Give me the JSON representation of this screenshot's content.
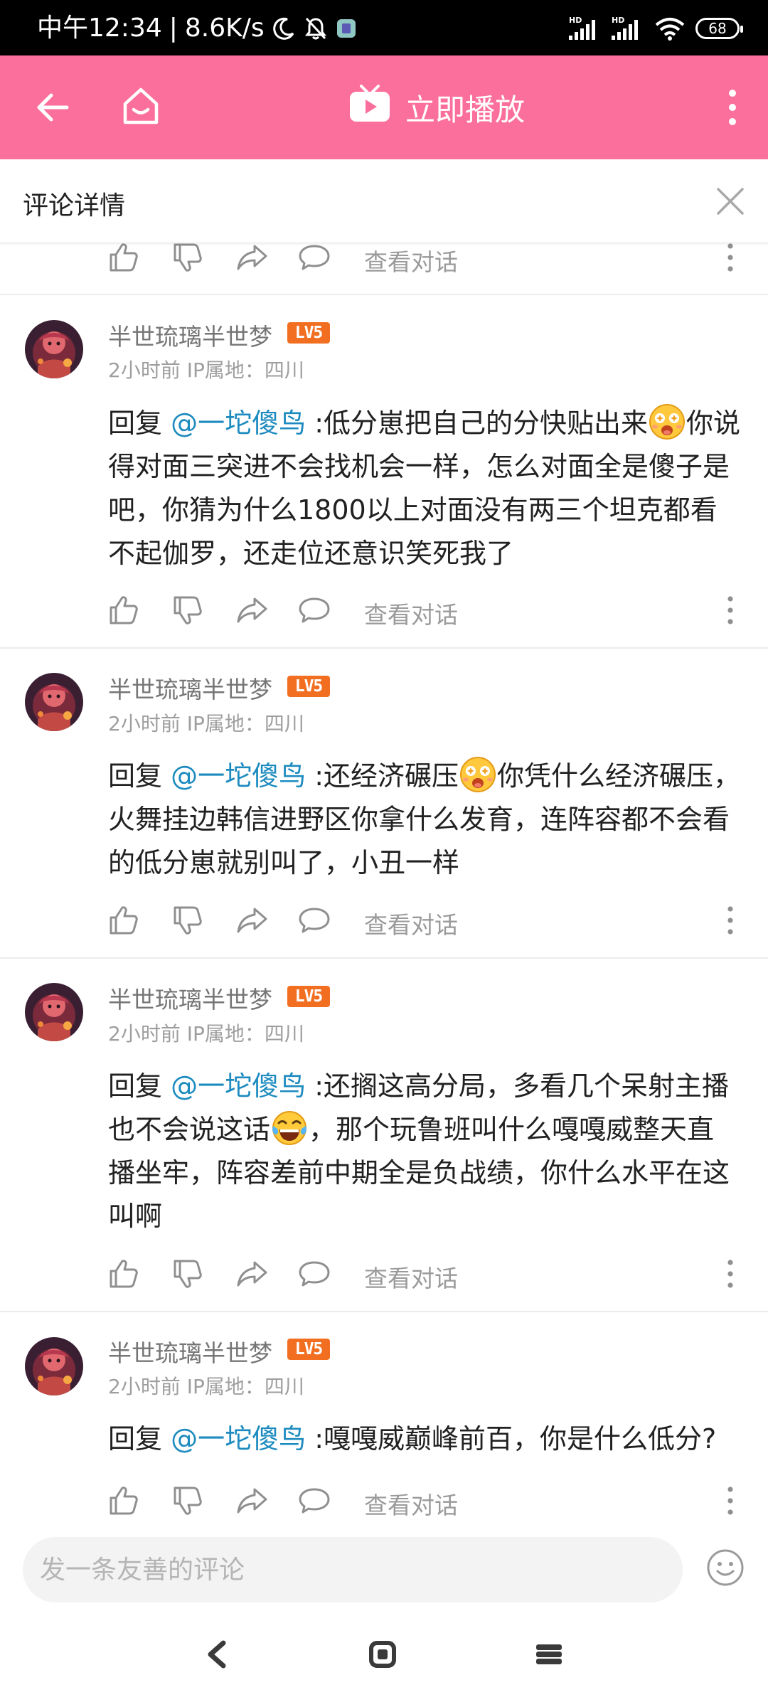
{
  "status_bar": {
    "time": "中午12:34",
    "speed": "8.6K/s",
    "separator": "|",
    "signal_label": "HD",
    "battery": "68"
  },
  "app_bar": {
    "play_label": "立即播放",
    "accent_color": "#fb6f9c"
  },
  "detail": {
    "title": "评论详情"
  },
  "actions": {
    "view_conversation": "查看对话"
  },
  "comments": [
    {
      "username": "半世琉璃半世梦",
      "level": "LV5",
      "time": "2小时前",
      "ip": "IP属地：四川",
      "prefix": "回复 ",
      "mention": "@一坨傻鸟",
      "text_a": " :低分崽把自己的分快贴出来",
      "emoji": "surprised-face-emoji",
      "text_b": "你说得对面三突进不会找机会一样，怎么对面全是傻子是吧，你猜为什么1800以上对面没有两三个坦克都看不起伽罗，还走位还意识笑死我了"
    },
    {
      "username": "半世琉璃半世梦",
      "level": "LV5",
      "time": "2小时前",
      "ip": "IP属地：四川",
      "prefix": "回复 ",
      "mention": "@一坨傻鸟",
      "text_a": " :还经济碾压",
      "emoji": "surprised-face-emoji",
      "text_b": "你凭什么经济碾压，火舞挂边韩信进野区你拿什么发育，连阵容都不会看的低分崽就别叫了，小丑一样"
    },
    {
      "username": "半世琉璃半世梦",
      "level": "LV5",
      "time": "2小时前",
      "ip": "IP属地：四川",
      "prefix": "回复 ",
      "mention": "@一坨傻鸟",
      "text_a": " :还搁这高分局，多看几个呆射主播也不会说这话",
      "emoji": "tears-of-joy-emoji",
      "text_b": "，那个玩鲁班叫什么嘎嘎威整天直播坐牢，阵容差前中期全是负战绩，你什么水平在这叫啊"
    },
    {
      "username": "半世琉璃半世梦",
      "level": "LV5",
      "time": "2小时前",
      "ip": "IP属地：四川",
      "prefix": "回复 ",
      "mention": "@一坨傻鸟",
      "text_a": " :嘎嘎威巅峰前百，你是什么低分?",
      "emoji": "",
      "text_b": ""
    }
  ],
  "input": {
    "placeholder": "发一条友善的评论"
  }
}
